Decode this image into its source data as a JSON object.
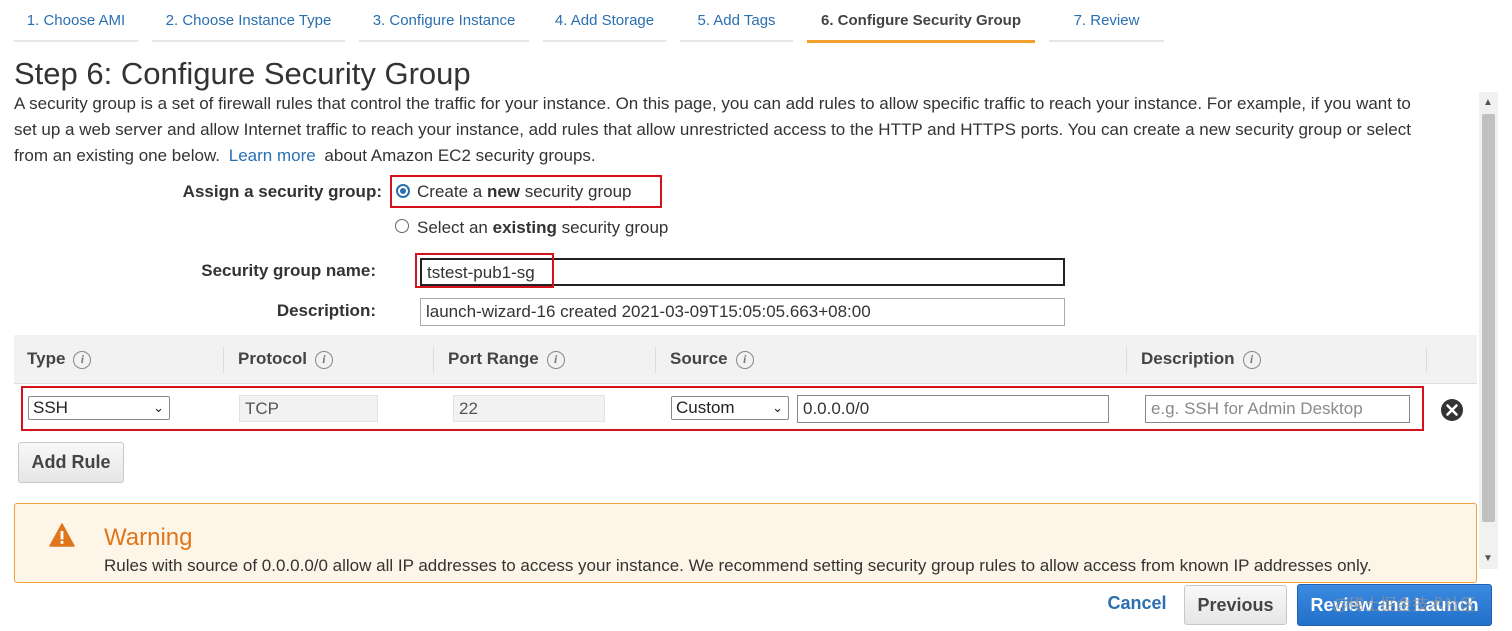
{
  "steps": [
    {
      "label": "1. Choose AMI",
      "active": false
    },
    {
      "label": "2. Choose Instance Type",
      "active": false
    },
    {
      "label": "3. Configure Instance",
      "active": false
    },
    {
      "label": "4. Add Storage",
      "active": false
    },
    {
      "label": "5. Add Tags",
      "active": false
    },
    {
      "label": "6. Configure Security Group",
      "active": true
    },
    {
      "label": "7. Review",
      "active": false
    }
  ],
  "page": {
    "title": "Step 6: Configure Security Group",
    "intro_line1": "A security group is a set of firewall rules that control the traffic for your instance. On this page, you can add rules to allow specific traffic to reach your instance. For example, if you want to",
    "intro_line2": "set up a web server and allow Internet traffic to reach your instance, add rules that allow unrestricted access to the HTTP and HTTPS ports. You can create a new security group or select",
    "intro_line3_pre": "from an existing one below.",
    "learn_more": "Learn more",
    "intro_line3_post": "about Amazon EC2 security groups."
  },
  "form": {
    "assign_label": "Assign a security group:",
    "option_new": {
      "pre": "Create a ",
      "bold": "new",
      "post": " security group",
      "selected": true
    },
    "option_existing": {
      "pre": "Select an ",
      "bold": "existing",
      "post": " security group",
      "selected": false
    },
    "name_label": "Security group name:",
    "name_value": "tstest-pub1-sg",
    "desc_label": "Description:",
    "desc_value": "launch-wizard-16 created 2021-03-09T15:05:05.663+08:00"
  },
  "rules_table": {
    "headers": [
      "Type",
      "Protocol",
      "Port Range",
      "Source",
      "Description"
    ],
    "info_glyph": "i",
    "rows": [
      {
        "type": "SSH",
        "protocol": "TCP",
        "port_range": "22",
        "source_mode": "Custom",
        "source_cidr": "0.0.0.0/0",
        "description_placeholder": "e.g. SSH for Admin Desktop"
      }
    ],
    "remove_icon": "close-circle-icon"
  },
  "add_rule_label": "Add Rule",
  "warning": {
    "icon": "warning-triangle-icon",
    "title": "Warning",
    "text": "Rules with source of 0.0.0.0/0 allow all IP addresses to access your instance. We recommend setting security group rules to allow access from known IP addresses only."
  },
  "footer": {
    "cancel": "Cancel",
    "previous": "Previous",
    "launch": "Review and Launch"
  },
  "watermark": "@稀土掘金技术社区",
  "colors": {
    "link": "#2a6fb0",
    "active_tab_underline": "#f29f2c",
    "highlight_box": "#d4121c",
    "primary_button": "#2f7bd3",
    "warning_border": "#f0a33a",
    "warning_text": "#e0761c"
  }
}
